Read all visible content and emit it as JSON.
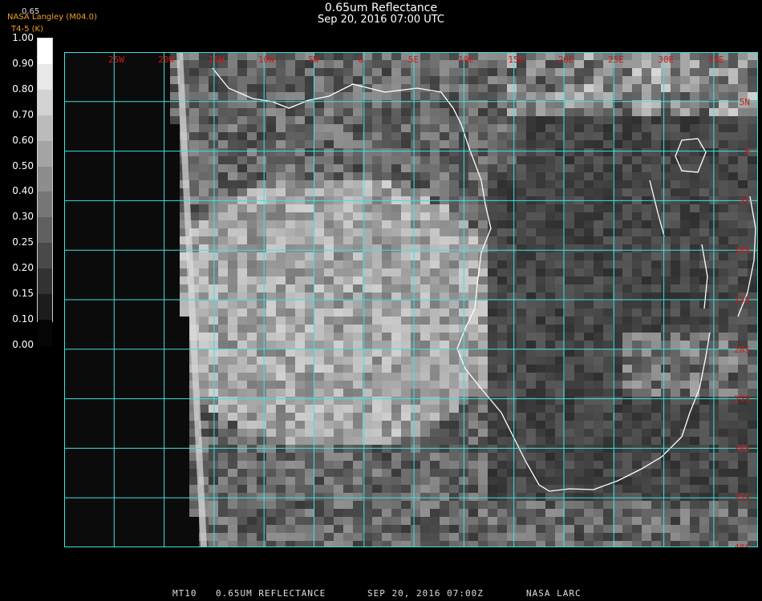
{
  "header": {
    "title": "0.65um Reflectance",
    "datetime": "Sep 20, 2016 07:00 UTC",
    "org": "NASA Langley (M04.0)",
    "band_label": "0.65",
    "sub_label": "T4-5 (K)"
  },
  "colorbar": {
    "ticks": [
      "1.00",
      "0.90",
      "0.80",
      "0.70",
      "0.60",
      "0.50",
      "0.40",
      "0.30",
      "0.25",
      "0.20",
      "0.15",
      "0.10",
      "0.00"
    ]
  },
  "map": {
    "lon_labels": [
      "25W",
      "20W",
      "15W",
      "10W",
      "5W",
      "0",
      "5E",
      "10E",
      "15E",
      "20E",
      "25E",
      "30E",
      "35E"
    ],
    "lat_labels": [
      "5N",
      "0",
      "5S",
      "10S",
      "15S",
      "20S",
      "25S",
      "30S",
      "35S",
      "40S"
    ],
    "grid_color": "#40e0e0",
    "label_color": "#d01818",
    "coast_color": "#ffffff"
  },
  "footer": {
    "product": "MT10",
    "band": "0.65UM REFLECTANCE",
    "date": "SEP 20, 2016 07:00Z",
    "source": "NASA LARC"
  }
}
